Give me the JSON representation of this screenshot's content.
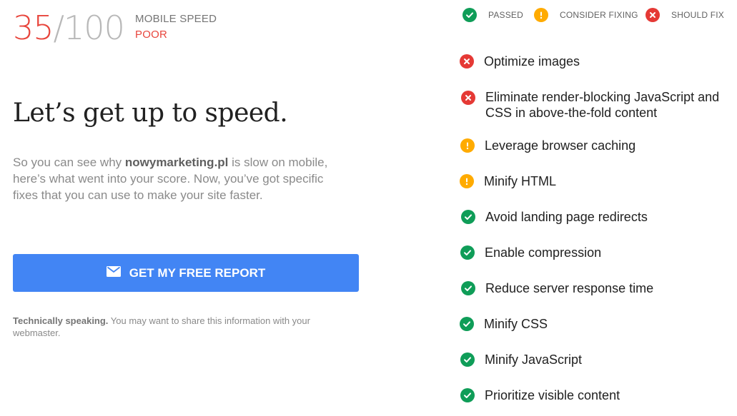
{
  "score": {
    "value": "35",
    "max": "/100",
    "label": "MOBILE SPEED",
    "rating": "POOR"
  },
  "legend": [
    {
      "label": "PASSED",
      "status": "pass"
    },
    {
      "label": "CONSIDER FIXING",
      "status": "warn"
    },
    {
      "label": "SHOULD FIX",
      "status": "fail"
    }
  ],
  "headline": "Let’s get up to speed.",
  "description": {
    "before": "So you can see why ",
    "site": "nowymarketing.pl",
    "after": " is slow on mobile, here’s what went into your score. Now, you’ve got specific fixes that you can use to make your site faster."
  },
  "cta": {
    "label": "GET MY FREE REPORT",
    "icon": "mail-icon"
  },
  "note": {
    "bold": "Technically speaking.",
    "text": " You may want to share this information with your webmaster."
  },
  "colors": {
    "pass": "#0f9d58",
    "warn": "#ffab00",
    "fail": "#e53935",
    "accent": "#4285f4",
    "score": "#e8453c"
  },
  "checks": [
    {
      "label": "Optimize images",
      "status": "fail"
    },
    {
      "label": "Eliminate render-blocking JavaScript and CSS in above-the-fold content",
      "status": "fail"
    },
    {
      "label": "Leverage browser caching",
      "status": "warn"
    },
    {
      "label": "Minify HTML",
      "status": "warn"
    },
    {
      "label": "Avoid landing page redirects",
      "status": "pass"
    },
    {
      "label": "Enable compression",
      "status": "pass"
    },
    {
      "label": "Reduce server response time",
      "status": "pass"
    },
    {
      "label": "Minify CSS",
      "status": "pass"
    },
    {
      "label": "Minify JavaScript",
      "status": "pass"
    },
    {
      "label": "Prioritize visible content",
      "status": "pass"
    }
  ]
}
